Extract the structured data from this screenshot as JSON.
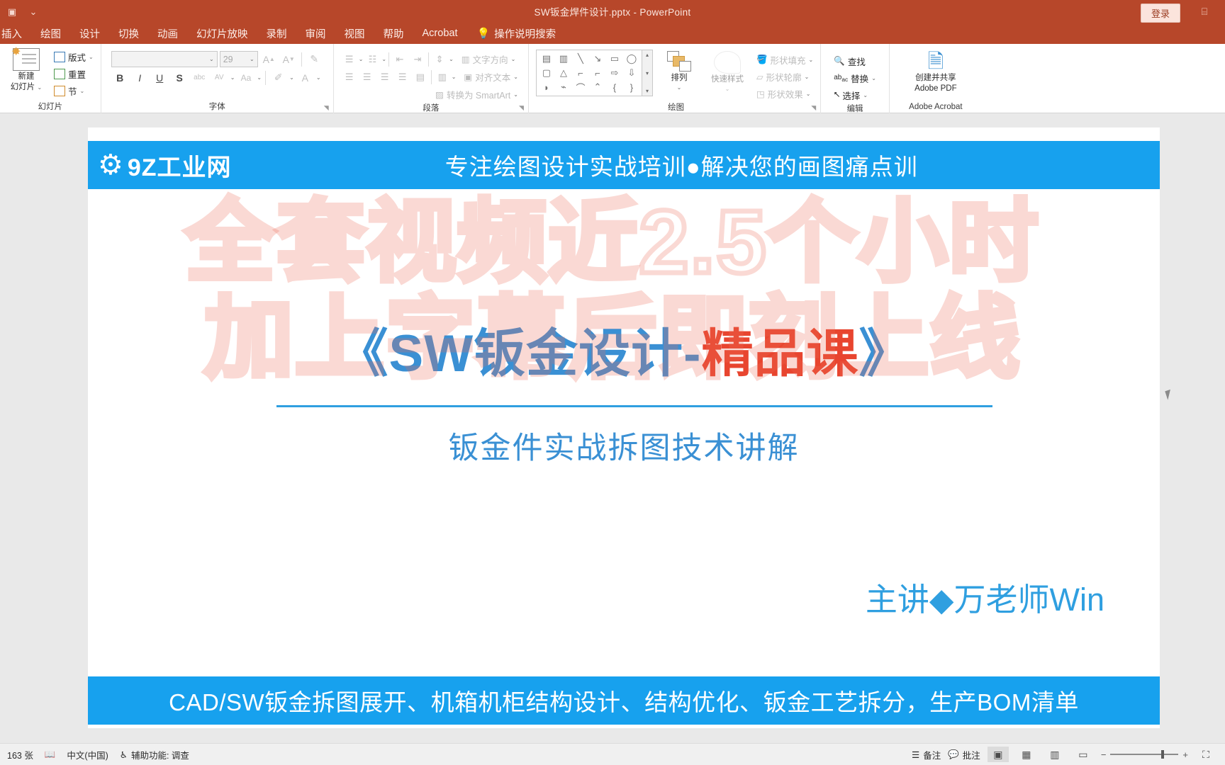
{
  "titlebar": {
    "document_title": "SW钣金焊件设计.pptx",
    "separator": "-",
    "app_name": "PowerPoint",
    "signin_label": "登录",
    "qat_icons": [
      "save-icon",
      "autosave-chevron"
    ],
    "ribbon_display_icon": "ribbon-display-icon",
    "background_color": "#b7472a"
  },
  "tabs": [
    {
      "label": "插入"
    },
    {
      "label": "绘图"
    },
    {
      "label": "设计"
    },
    {
      "label": "切换"
    },
    {
      "label": "动画"
    },
    {
      "label": "幻灯片放映"
    },
    {
      "label": "录制"
    },
    {
      "label": "审阅"
    },
    {
      "label": "视图"
    },
    {
      "label": "帮助"
    },
    {
      "label": "Acrobat"
    }
  ],
  "tellme": {
    "label": "操作说明搜索",
    "icon": "lightbulb-icon"
  },
  "ribbon": {
    "groups": [
      {
        "label": "幻灯片",
        "big_button": {
          "caption_line1": "新建",
          "caption_line2": "幻灯片",
          "icon": "new-slide-icon"
        },
        "small_buttons": [
          {
            "label": "版式",
            "icon": "layout-icon",
            "has_caret": true
          },
          {
            "label": "重置",
            "icon": "reset-icon",
            "has_caret": false
          },
          {
            "label": "节",
            "icon": "section-icon",
            "has_caret": true
          }
        ]
      },
      {
        "label": "字体",
        "font_name_value": "",
        "font_size_value": "29",
        "buttons": [
          {
            "name": "grow-font",
            "glyph": "A"
          },
          {
            "name": "shrink-font",
            "glyph": "A"
          },
          {
            "name": "clear-formatting",
            "glyph": "✎"
          },
          {
            "name": "bold",
            "glyph": "B"
          },
          {
            "name": "italic",
            "glyph": "I"
          },
          {
            "name": "underline",
            "glyph": "U"
          },
          {
            "name": "text-shadow",
            "glyph": "S"
          },
          {
            "name": "strikethrough",
            "glyph": "abc"
          },
          {
            "name": "character-spacing",
            "glyph": "AV"
          },
          {
            "name": "change-case",
            "glyph": "Aa"
          },
          {
            "name": "text-highlight",
            "glyph": "✏"
          },
          {
            "name": "font-color",
            "glyph": "A"
          }
        ]
      },
      {
        "label": "段落",
        "buttons": [
          {
            "name": "bullets",
            "glyph": "☰"
          },
          {
            "name": "numbering",
            "glyph": "☳"
          },
          {
            "name": "decrease-indent",
            "glyph": "⇤"
          },
          {
            "name": "increase-indent",
            "glyph": "⇥"
          },
          {
            "name": "line-spacing",
            "glyph": "↕"
          },
          {
            "name": "align-left",
            "glyph": "☰"
          },
          {
            "name": "align-center",
            "glyph": "☰"
          },
          {
            "name": "align-right",
            "glyph": "☰"
          },
          {
            "name": "justify",
            "glyph": "☰"
          },
          {
            "name": "columns",
            "glyph": "▤"
          },
          {
            "name": "text-direction-small",
            "glyph": "▥"
          }
        ],
        "labeled": [
          {
            "label": "文字方向",
            "icon": "text-direction-icon",
            "has_caret": true
          },
          {
            "label": "对齐文本",
            "icon": "align-text-icon",
            "has_caret": true
          },
          {
            "label": "转换为 SmartArt",
            "icon": "smartart-icon",
            "has_caret": true
          }
        ]
      },
      {
        "label": "绘图",
        "shapes_gallery": [
          "▤",
          "▥",
          "╲",
          "↘",
          "▭",
          "◯",
          "▢",
          "△",
          "⌐",
          "⌐",
          "⇨",
          "⇩",
          "◗",
          "⌁",
          "⌒",
          "⌃",
          "{",
          "}"
        ],
        "arrange": {
          "label": "排列",
          "icon": "arrange-icon"
        },
        "quick_styles": {
          "label": "快速样式",
          "icon": "quick-styles-icon"
        },
        "shape_buttons": [
          {
            "label": "形状填充",
            "icon": "shape-fill-icon"
          },
          {
            "label": "形状轮廓",
            "icon": "shape-outline-icon"
          },
          {
            "label": "形状效果",
            "icon": "shape-effects-icon"
          }
        ]
      },
      {
        "label": "编辑",
        "buttons": [
          {
            "label": "查找",
            "icon": "search-icon",
            "has_caret": false
          },
          {
            "label": "替换",
            "icon": "replace-icon",
            "has_caret": true
          },
          {
            "label": "选择",
            "icon": "select-icon",
            "has_caret": true
          }
        ]
      },
      {
        "label": "Adobe Acrobat",
        "big_button": {
          "caption_line1": "创建并共享",
          "caption_line2": "Adobe PDF",
          "icon": "create-pdf-icon"
        }
      }
    ]
  },
  "slide": {
    "top_banner": {
      "logo_text": "9Z工业网",
      "logo_icon": "gear-icon",
      "tagline": "专注绘图设计实战培训●解决您的画图痛点训",
      "background_color": "#17a1ee"
    },
    "title_part1": "《SW钣金设计-",
    "title_part2": "精品课",
    "title_part3": "》",
    "title_color": "#3a90d4",
    "title_accent_color": "#e8452f",
    "subtitle": "钣金件实战拆图技术讲解",
    "presenter": "主讲◆万老师Win",
    "bottom_banner": "CAD/SW钣金拆图展开、机箱机柜结构设计、结构优化、钣金工艺拆分，生产BOM清单"
  },
  "watermark": {
    "line1": "全套视频近2.5个小时",
    "line2": "加上字幕后即刻上线",
    "color": "#ed6e5a"
  },
  "statusbar": {
    "slide_count": "163 张",
    "language": "中文(中国)",
    "accessibility": "辅助功能: 调查",
    "notes_label": "备注",
    "comments_label": "批注",
    "views": [
      {
        "name": "normal-view",
        "glyph": "▣"
      },
      {
        "name": "slide-sorter-view",
        "glyph": "▦"
      },
      {
        "name": "reading-view",
        "glyph": "▥"
      },
      {
        "name": "slide-show-view",
        "glyph": "▭"
      }
    ],
    "zoom_minus": "−",
    "zoom_plus": "+"
  }
}
